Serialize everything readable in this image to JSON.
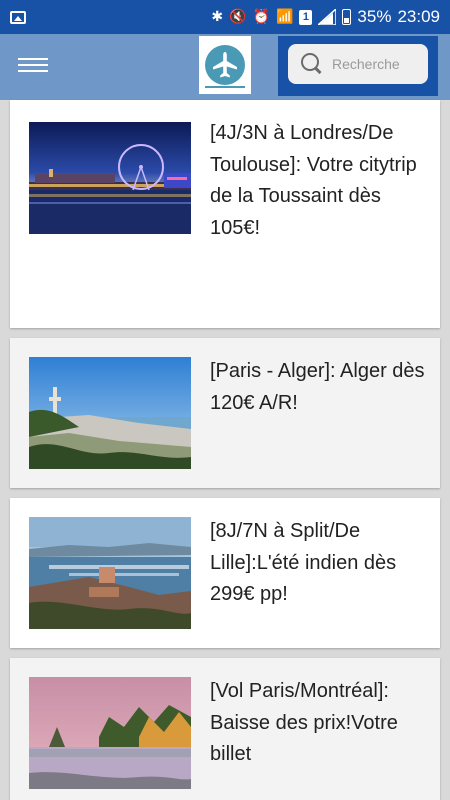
{
  "status_bar": {
    "battery_percent": "35%",
    "time": "23:09",
    "sim_number": "1",
    "icons": [
      "image-icon",
      "bluetooth-icon",
      "mute-icon",
      "alarm-icon",
      "wifi-icon",
      "sim-icon",
      "signal-icon",
      "battery-icon"
    ]
  },
  "app_bar": {
    "logo_icon": "airplane-icon",
    "search": {
      "placeholder": "Recherche"
    }
  },
  "colors": {
    "status_bar": "#1752a6",
    "app_bar": "#6f98c8",
    "logo": "#4a9ab6",
    "card_text": "#222222"
  },
  "articles": [
    {
      "title": "[4J/3N à Londres/De Toulouse]: Votre citytrip de la Toussaint dès 105€!",
      "image": "london-night-skyline"
    },
    {
      "title": "[Paris - Alger]: Alger dès 120€ A/R!",
      "image": "algiers-bay-view"
    },
    {
      "title": "[8J/7N à Split/De Lille]:L'été indien dès 299€ pp!",
      "image": "split-harbor-view"
    },
    {
      "title": "[Vol Paris/Montréal]: Baisse des prix!Votre billet",
      "image": "canadian-lake-autumn"
    }
  ]
}
